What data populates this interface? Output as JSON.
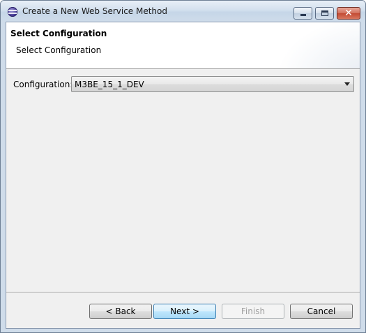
{
  "window": {
    "title": "Create a New Web Service Method",
    "controls": {
      "minimize": "minimize",
      "maximize": "maximize",
      "close_glyph": "✕"
    }
  },
  "banner": {
    "title": "Select Configuration",
    "description": "Select Configuration"
  },
  "form": {
    "configuration_label": "Configuration:",
    "configuration_value": "M3BE_15_1_DEV"
  },
  "buttons": {
    "back": "< Back",
    "next": "Next >",
    "finish": "Finish",
    "cancel": "Cancel"
  },
  "icons": {
    "app": "eclipse-icon",
    "dropdown": "chevron-down-icon"
  }
}
